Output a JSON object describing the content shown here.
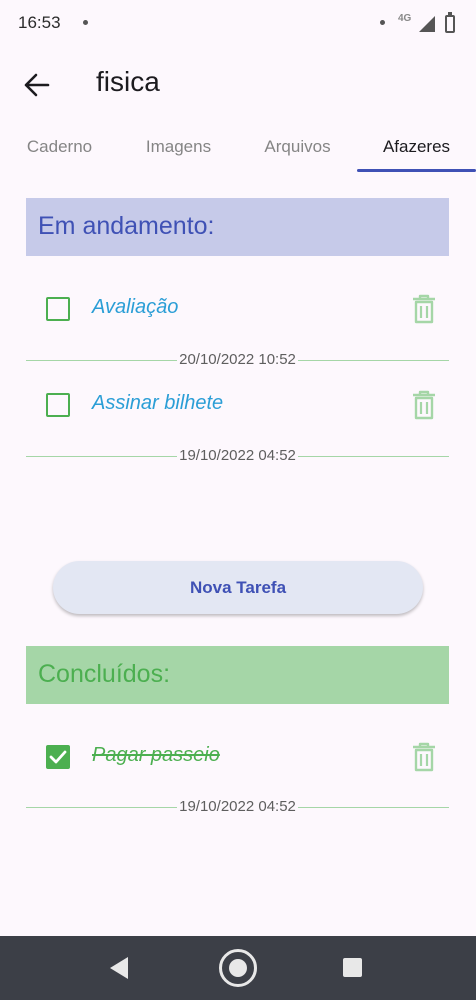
{
  "status_bar": {
    "time": "16:53",
    "network": "4G"
  },
  "app_bar": {
    "title": "fisica"
  },
  "tabs": [
    {
      "label": "Caderno",
      "active": false
    },
    {
      "label": "Imagens",
      "active": false
    },
    {
      "label": "Arquivos",
      "active": false
    },
    {
      "label": "Afazeres",
      "active": true
    }
  ],
  "sections": {
    "in_progress": {
      "title": "Em andamento:",
      "tasks": [
        {
          "title": "Avaliação",
          "checked": false,
          "date": "20/10/2022 10:52"
        },
        {
          "title": "Assinar bilhete",
          "checked": false,
          "date": "19/10/2022 04:52"
        }
      ]
    },
    "done": {
      "title": "Concluídos:",
      "tasks": [
        {
          "title": "Pagar passeio",
          "checked": true,
          "date": "19/10/2022 04:52"
        }
      ]
    }
  },
  "new_task_button": {
    "label": "Nova Tarefa"
  },
  "colors": {
    "accent": "#3f51b5",
    "green": "#4caf50",
    "in_progress_header_bg": "#c6cae9",
    "done_header_bg": "#a5d6a7",
    "task_title": "#2b9ed6"
  },
  "icons": {
    "back": "arrow-back-icon",
    "delete": "trash-icon",
    "check": "check-icon"
  }
}
